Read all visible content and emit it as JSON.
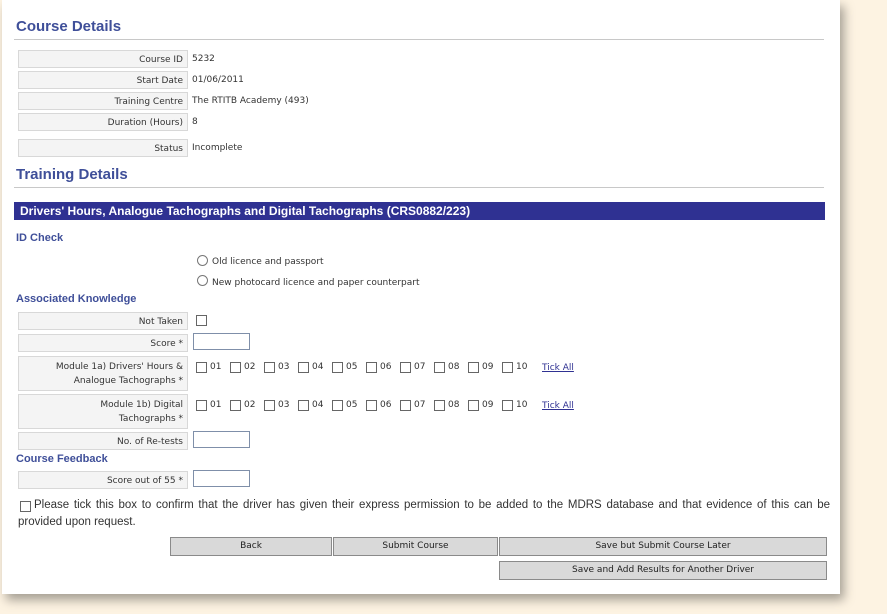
{
  "course": {
    "title": "Course Details",
    "rows": [
      {
        "label": "Course ID",
        "value": "5232"
      },
      {
        "label": "Start Date",
        "value": "01/06/2011"
      },
      {
        "label": "Training Centre",
        "value": "The RTITB Academy (493)"
      },
      {
        "label": "Duration (Hours)",
        "value": "8"
      },
      {
        "label": "Status",
        "value": "Incomplete"
      }
    ]
  },
  "training": {
    "title": "Training Details",
    "bar": "Drivers' Hours, Analogue Tachographs and Digital Tachographs (CRS0882/223)",
    "id_check": {
      "label": "ID Check",
      "options": [
        "Old licence and passport",
        "New photocard licence and paper counterpart"
      ]
    },
    "knowledge": {
      "label": "Associated Knowledge",
      "not_taken": "Not Taken",
      "score": "Score *",
      "module_a_line1": "Module 1a) Drivers' Hours &",
      "module_a_line2": "Analogue Tachographs *",
      "module_b_line1": "Module 1b) Digital",
      "module_b_line2": "Tachographs *",
      "modules": [
        "01",
        "02",
        "03",
        "04",
        "05",
        "06",
        "07",
        "08",
        "09",
        "10"
      ],
      "tick_all": "Tick All",
      "retests": "No. of Re-tests"
    },
    "feedback": {
      "label": "Course Feedback",
      "score": "Score out of 55 *"
    },
    "consent": "Please tick this box to confirm that the driver has given their express permission to be added to the MDRS database and that evidence of this can be provided upon request."
  },
  "buttons": {
    "back": "Back",
    "submit": "Submit Course",
    "save_later": "Save but Submit Course Later",
    "save_another": "Save and Add Results for Another Driver"
  },
  "colors": {
    "accent": "#2f3192",
    "heading": "#3f4f99",
    "page_bg": "#fdf3e2"
  }
}
